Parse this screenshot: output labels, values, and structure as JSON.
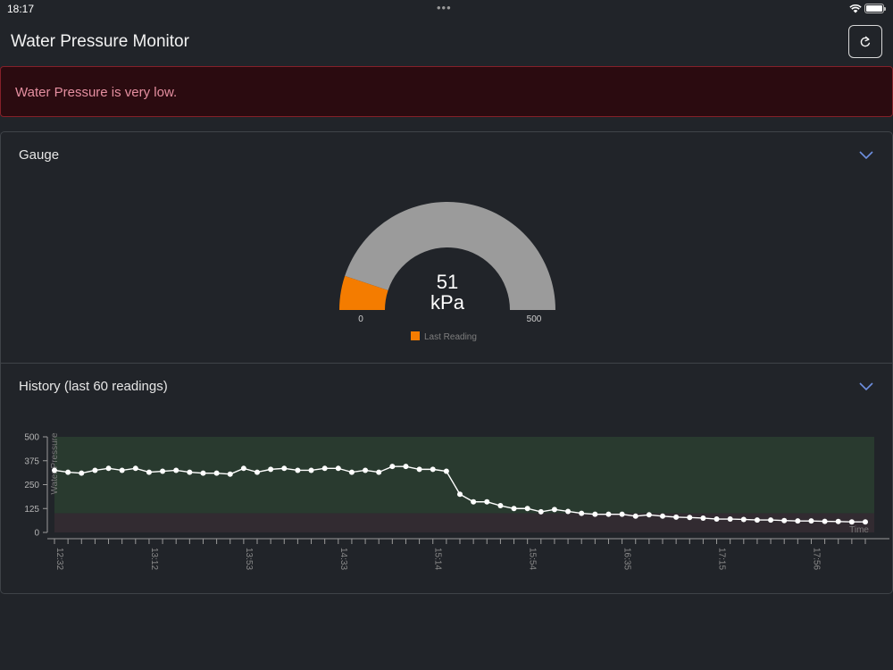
{
  "status_bar": {
    "time": "18:17",
    "dots": "•••"
  },
  "header": {
    "title": "Water Pressure Monitor"
  },
  "alert": {
    "message": "Water Pressure is very low.",
    "color": "#e58fa0",
    "background": "#2b0b10"
  },
  "gauge": {
    "title": "Gauge",
    "value": "51",
    "unit": "kPa",
    "min": "0",
    "max": "500",
    "legend": "Last Reading",
    "fill_color": "#f47c00",
    "track_color": "#9b9b9b"
  },
  "history": {
    "title": "History (last 60 readings)"
  },
  "chart_data": {
    "type": "line",
    "ylabel": "Water Pressure",
    "xlabel": "Time",
    "ylim": [
      0,
      500
    ],
    "yticks": [
      0,
      125,
      250,
      375,
      500
    ],
    "x_tick_labels": [
      "12:32",
      "13:12",
      "13:53",
      "14:33",
      "15:14",
      "15:54",
      "16:35",
      "17:15",
      "17:56"
    ],
    "bands": [
      {
        "from": 100,
        "to": 500,
        "color": "#293a2f"
      },
      {
        "from": 0,
        "to": 100,
        "color": "#322b31"
      }
    ],
    "series": [
      {
        "color": "#ffffff",
        "values": [
          325,
          315,
          310,
          325,
          335,
          325,
          335,
          315,
          320,
          325,
          315,
          310,
          310,
          305,
          335,
          315,
          330,
          335,
          325,
          325,
          335,
          335,
          315,
          325,
          315,
          345,
          345,
          330,
          330,
          320,
          200,
          160,
          160,
          140,
          125,
          125,
          108,
          120,
          110,
          100,
          95,
          95,
          95,
          85,
          92,
          85,
          80,
          78,
          75,
          70,
          70,
          68,
          65,
          65,
          62,
          60,
          60,
          58,
          57,
          55,
          55
        ]
      }
    ]
  }
}
